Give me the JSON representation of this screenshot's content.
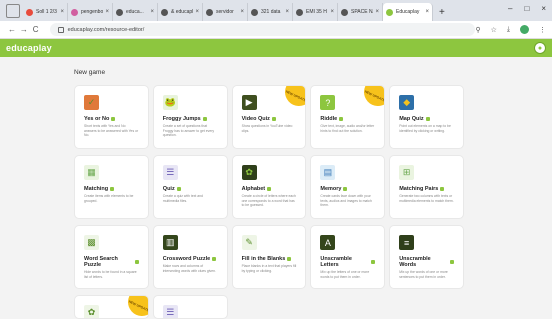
{
  "browser": {
    "tabs": [
      {
        "label": "Soll 1 2/3",
        "color": "#e84b3c"
      },
      {
        "label": "pengenbo",
        "color": "#d15fa0"
      },
      {
        "label": "educa...",
        "color": "#555555"
      },
      {
        "label": "& educapl",
        "color": "#555555"
      },
      {
        "label": "servidor",
        "color": "#555555"
      },
      {
        "label": "321 data",
        "color": "#555555"
      },
      {
        "label": "EMI 35 H",
        "color": "#555555"
      },
      {
        "label": "SPACE NAI",
        "color": "#555555"
      },
      {
        "label": "Educaplay",
        "color": "#8dc63f",
        "active": true
      }
    ],
    "new_tab": "+",
    "window_controls": [
      "–",
      "□",
      "×"
    ],
    "url": "educaplay.com/resource-editor/",
    "back": "←",
    "forward": "→",
    "reload": "C"
  },
  "header": {
    "logo": "educaplay"
  },
  "page": {
    "title": "New game"
  },
  "games": [
    {
      "name": "Yes or No",
      "desc": "Short texts with Yes and No answers to be answered with Yes or No.",
      "icon_bg": "#e0793a",
      "icon_fg": "#5b8f2d",
      "icon": "✓",
      "badge": ""
    },
    {
      "name": "Froggy Jumps",
      "desc": "Create a set of questions that Froggy has to answer to get every question.",
      "icon_bg": "#e8f3dc",
      "icon_fg": "#3d6b25",
      "icon": "🐸",
      "badge": ""
    },
    {
      "name": "Video Quiz",
      "desc": "Show questions in YouTube video clips.",
      "icon_bg": "#3f4f1f",
      "icon_fg": "#ffffff",
      "icon": "▶",
      "badge": "NEW UPDATED"
    },
    {
      "name": "Riddle",
      "desc": "Give text, image, audio and/or letter hints to find out the solution.",
      "icon_bg": "#8dc63f",
      "icon_fg": "#ffffff",
      "icon": "?",
      "badge": "NEW UPDATED"
    },
    {
      "name": "Map Quiz",
      "desc": "Point out elements on a map to be identified by clicking or writing.",
      "icon_bg": "#2d6fa8",
      "icon_fg": "#f4c21e",
      "icon": "◆",
      "badge": ""
    },
    {
      "name": "Matching",
      "desc": "Create items with elements to be grouped.",
      "icon_bg": "#eaf4e0",
      "icon_fg": "#6aa84f",
      "icon": "▦",
      "badge": ""
    },
    {
      "name": "Quiz",
      "desc": "Create a quiz with text and multimedia files.",
      "icon_bg": "#e8e6f5",
      "icon_fg": "#6a5bb5",
      "icon": "☰",
      "badge": ""
    },
    {
      "name": "Alphabet",
      "desc": "Create a circle of letters where each one corresponds to a word that has to be guessed.",
      "icon_bg": "#2f3f1a",
      "icon_fg": "#8dc63f",
      "icon": "✿",
      "badge": ""
    },
    {
      "name": "Memory",
      "desc": "Create cards face down with your texts, audios and images to match them.",
      "icon_bg": "#dcecf7",
      "icon_fg": "#3b7ab8",
      "icon": "▤",
      "badge": ""
    },
    {
      "name": "Matching Pairs",
      "desc": "Generate two columns with texts or multimedia elements to match them.",
      "icon_bg": "#eaf4e0",
      "icon_fg": "#6aa84f",
      "icon": "⊞",
      "badge": ""
    },
    {
      "name": "Word Search Puzzle",
      "desc": "Hide words to be found in a square list of letters.",
      "icon_bg": "#eef5e6",
      "icon_fg": "#5b8f2d",
      "icon": "▩",
      "badge": ""
    },
    {
      "name": "Crossword Puzzle",
      "desc": "Make rows and columns of intersecting words with clues given.",
      "icon_bg": "#34461b",
      "icon_fg": "#ffffff",
      "icon": "▥",
      "badge": ""
    },
    {
      "name": "Fill in the Blanks",
      "desc": "Place blanks in a text that players fill by typing or clicking.",
      "icon_bg": "#eef5e6",
      "icon_fg": "#5b8f2d",
      "icon": "✎",
      "badge": ""
    },
    {
      "name": "Unscramble Letters",
      "desc": "Mix up the letters of one or more words to put them in order.",
      "icon_bg": "#34461b",
      "icon_fg": "#ffffff",
      "icon": "A",
      "badge": ""
    },
    {
      "name": "Unscramble Words",
      "desc": "Mix up the words of one or more sentences to put them in order.",
      "icon_bg": "#2f3f1a",
      "icon_fg": "#ffffff",
      "icon": "≡",
      "badge": ""
    },
    {
      "name": "",
      "desc": "",
      "icon_bg": "#eef5e6",
      "icon_fg": "#5b8f2d",
      "icon": "✿",
      "badge": "NEW UPDATED",
      "partial": true
    },
    {
      "name": "",
      "desc": "",
      "icon_bg": "#e8e6f5",
      "icon_fg": "#6a5bb5",
      "icon": "☰",
      "badge": "",
      "partial": true
    }
  ]
}
